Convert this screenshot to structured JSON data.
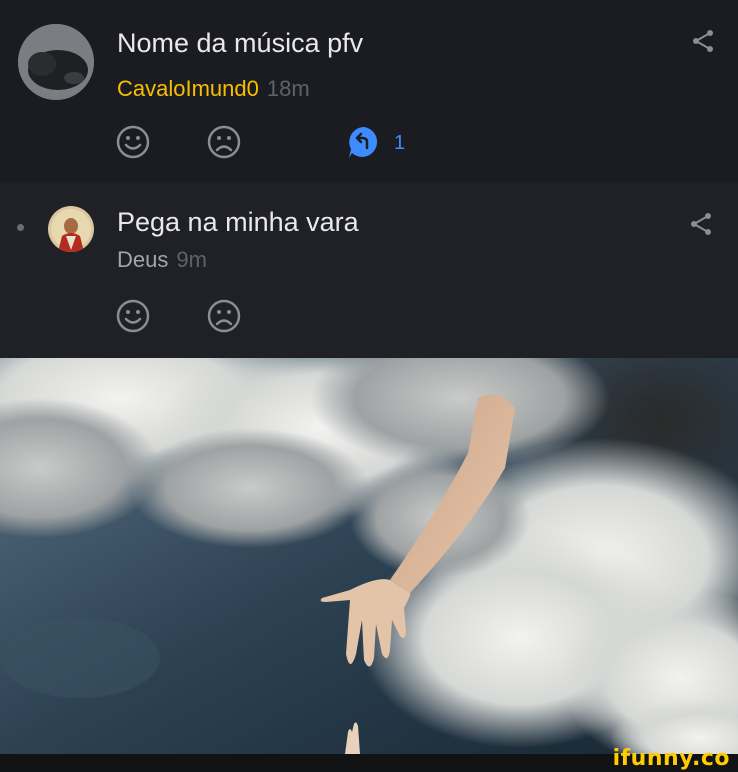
{
  "comments": [
    {
      "title": "Nome da música pfv",
      "author": "CavaloImund0",
      "time": "18m",
      "reply_count": "1",
      "author_color": "#f6c000"
    },
    {
      "title": "Pega na minha vara",
      "author": "Deus",
      "time": "9m",
      "author_color": "#a3a5ab"
    }
  ],
  "icons": {
    "share": "share-icon",
    "like": "smile-face-icon",
    "dislike": "sad-face-icon",
    "reply": "reply-bubble-icon"
  },
  "colors": {
    "background": "#17181d",
    "accent_reply": "#3d8cff",
    "watermark": "#ffcc00"
  },
  "watermark": "ifunny.co"
}
